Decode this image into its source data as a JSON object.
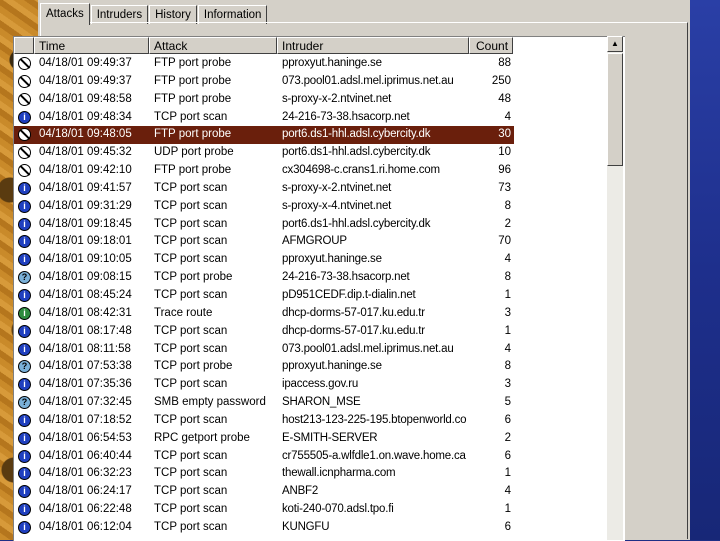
{
  "tabs": [
    {
      "label": "Attacks",
      "active": true
    },
    {
      "label": "Intruders",
      "active": false
    },
    {
      "label": "History",
      "active": false
    },
    {
      "label": "Information",
      "active": false
    }
  ],
  "columns": {
    "time": "Time",
    "attack": "Attack",
    "intruder": "Intruder",
    "count": "Count"
  },
  "rows": [
    {
      "icon": "ftp-probe-icon",
      "time": "04/18/01 09:49:37",
      "attack": "FTP port probe",
      "intruder": "pproxyut.haninge.se",
      "count": "88"
    },
    {
      "icon": "ftp-probe-icon",
      "time": "04/18/01 09:49:37",
      "attack": "FTP port probe",
      "intruder": "073.pool01.adsl.mel.iprimus.net.au",
      "count": "250"
    },
    {
      "icon": "ftp-probe-icon",
      "time": "04/18/01 09:48:58",
      "attack": "FTP port probe",
      "intruder": "s-proxy-x-2.ntvinet.net",
      "count": "48"
    },
    {
      "icon": "info-icon",
      "time": "04/18/01 09:48:34",
      "attack": "TCP port scan",
      "intruder": "24-216-73-38.hsacorp.net",
      "count": "4"
    },
    {
      "icon": "ftp-probe-icon",
      "time": "04/18/01 09:48:05",
      "attack": "FTP port probe",
      "intruder": "port6.ds1-hhl.adsl.cybercity.dk",
      "count": "30",
      "selected": true
    },
    {
      "icon": "ftp-probe-icon",
      "time": "04/18/01 09:45:32",
      "attack": "UDP port probe",
      "intruder": "port6.ds1-hhl.adsl.cybercity.dk",
      "count": "10"
    },
    {
      "icon": "ftp-probe-icon",
      "time": "04/18/01 09:42:10",
      "attack": "FTP port probe",
      "intruder": "cx304698-c.crans1.ri.home.com",
      "count": "96"
    },
    {
      "icon": "info-icon",
      "time": "04/18/01 09:41:57",
      "attack": "TCP port scan",
      "intruder": "s-proxy-x-2.ntvinet.net",
      "count": "73"
    },
    {
      "icon": "info-icon",
      "time": "04/18/01 09:31:29",
      "attack": "TCP port scan",
      "intruder": "s-proxy-x-4.ntvinet.net",
      "count": "8"
    },
    {
      "icon": "info-icon",
      "time": "04/18/01 09:18:45",
      "attack": "TCP port scan",
      "intruder": "port6.ds1-hhl.adsl.cybercity.dk",
      "count": "2"
    },
    {
      "icon": "info-icon",
      "time": "04/18/01 09:18:01",
      "attack": "TCP port scan",
      "intruder": "AFMGROUP",
      "count": "70"
    },
    {
      "icon": "info-icon",
      "time": "04/18/01 09:10:05",
      "attack": "TCP port scan",
      "intruder": "pproxyut.haninge.se",
      "count": "4"
    },
    {
      "icon": "question-icon",
      "time": "04/18/01 09:08:15",
      "attack": "TCP port probe",
      "intruder": "24-216-73-38.hsacorp.net",
      "count": "8"
    },
    {
      "icon": "info-icon",
      "time": "04/18/01 08:45:24",
      "attack": "TCP port scan",
      "intruder": "pD951CEDF.dip.t-dialin.net",
      "count": "1"
    },
    {
      "icon": "trace-route-icon",
      "time": "04/18/01 08:42:31",
      "attack": "Trace route",
      "intruder": "dhcp-dorms-57-017.ku.edu.tr",
      "count": "3"
    },
    {
      "icon": "info-icon",
      "time": "04/18/01 08:17:48",
      "attack": "TCP port scan",
      "intruder": "dhcp-dorms-57-017.ku.edu.tr",
      "count": "1"
    },
    {
      "icon": "info-icon",
      "time": "04/18/01 08:11:58",
      "attack": "TCP port scan",
      "intruder": "073.pool01.adsl.mel.iprimus.net.au",
      "count": "4"
    },
    {
      "icon": "question-icon",
      "time": "04/18/01 07:53:38",
      "attack": "TCP port probe",
      "intruder": "pproxyut.haninge.se",
      "count": "8"
    },
    {
      "icon": "info-icon",
      "time": "04/18/01 07:35:36",
      "attack": "TCP port scan",
      "intruder": "ipaccess.gov.ru",
      "count": "3"
    },
    {
      "icon": "question-icon",
      "time": "04/18/01 07:32:45",
      "attack": "SMB empty password",
      "intruder": "SHARON_MSE",
      "count": "5"
    },
    {
      "icon": "info-icon",
      "time": "04/18/01 07:18:52",
      "attack": "TCP port scan",
      "intruder": "host213-123-225-195.btopenworld.co",
      "count": "6"
    },
    {
      "icon": "info-icon",
      "time": "04/18/01 06:54:53",
      "attack": "RPC getport probe",
      "intruder": "E-SMITH-SERVER",
      "count": "2"
    },
    {
      "icon": "info-icon",
      "time": "04/18/01 06:40:44",
      "attack": "TCP port scan",
      "intruder": "cr755505-a.wlfdle1.on.wave.home.ca",
      "count": "6"
    },
    {
      "icon": "info-icon",
      "time": "04/18/01 06:32:23",
      "attack": "TCP port scan",
      "intruder": "thewall.icnpharma.com",
      "count": "1"
    },
    {
      "icon": "info-icon",
      "time": "04/18/01 06:24:17",
      "attack": "TCP port scan",
      "intruder": "ANBF2",
      "count": "4"
    },
    {
      "icon": "info-icon",
      "time": "04/18/01 06:22:48",
      "attack": "TCP port scan",
      "intruder": "koti-240-070.adsl.tpo.fi",
      "count": "1"
    },
    {
      "icon": "info-icon",
      "time": "04/18/01 06:12:04",
      "attack": "TCP port scan",
      "intruder": "KUNGFU",
      "count": "6"
    }
  ]
}
